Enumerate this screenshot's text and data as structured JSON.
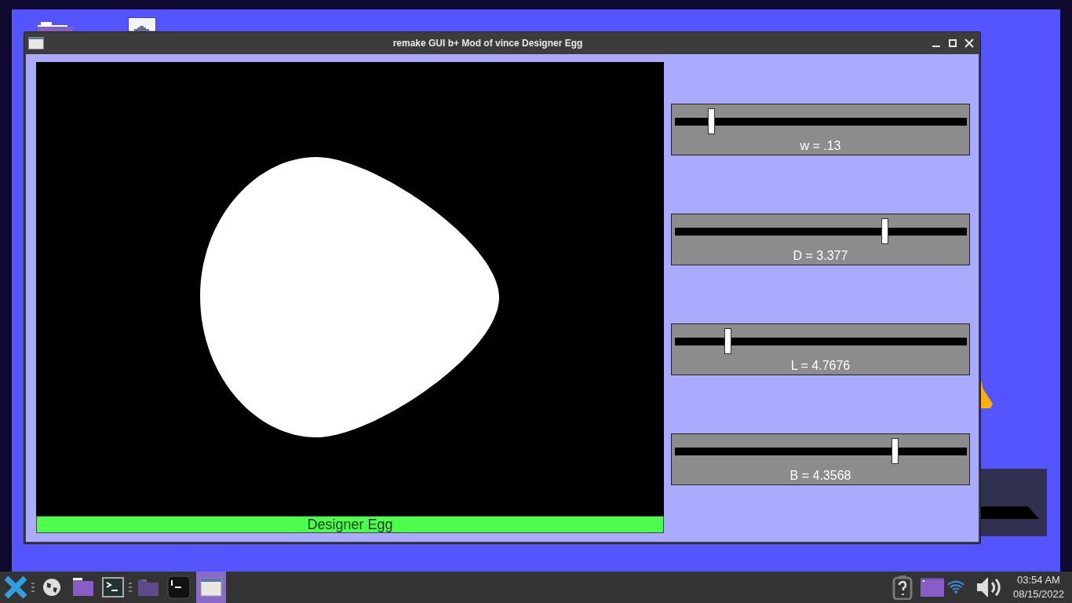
{
  "window": {
    "title": "remake GUI b+ Mod of vince Designer Egg"
  },
  "canvas": {
    "caption": "Designer Egg"
  },
  "sliders": [
    {
      "label": "w = .13",
      "level": 0.126
    },
    {
      "label": "D = 3.377",
      "level": 0.72
    },
    {
      "label": "L = 4.7676",
      "level": 0.183
    },
    {
      "label": "B = 4.3568",
      "level": 0.755
    }
  ],
  "taskbar": {
    "time": "03:54 AM",
    "date": "08/15/2022"
  }
}
